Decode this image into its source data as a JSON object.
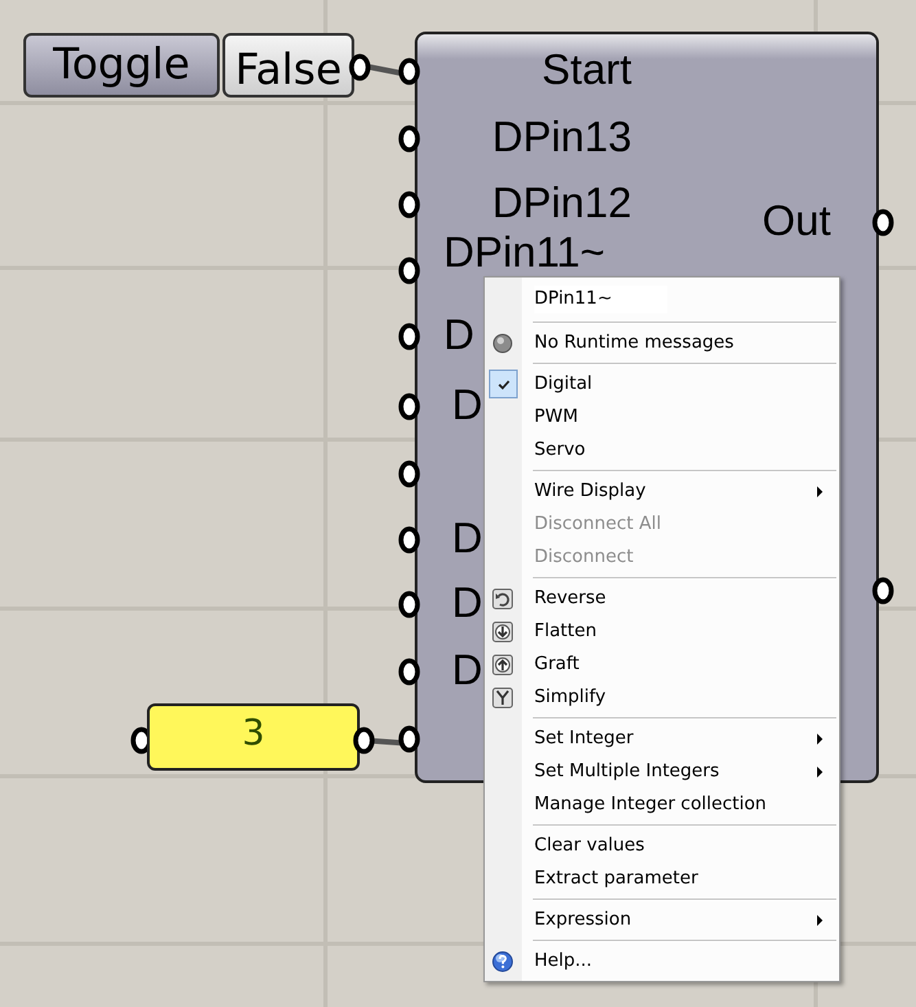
{
  "toggle": {
    "label": "Toggle",
    "value": "False"
  },
  "component": {
    "inputs": [
      {
        "kind": "labeled",
        "label": "Start"
      },
      {
        "kind": "labeled",
        "label": "DPin13"
      },
      {
        "kind": "labeled",
        "label": "DPin12"
      },
      {
        "kind": "labeled",
        "label": "DPin11~"
      },
      {
        "kind": "labeled",
        "label": "D"
      },
      {
        "kind": "labeled",
        "label": "D"
      },
      {
        "kind": "unlabeled"
      },
      {
        "kind": "labeled",
        "label": "D"
      },
      {
        "kind": "labeled",
        "label": "D"
      },
      {
        "kind": "labeled",
        "label": "D"
      },
      {
        "kind": "unlabeled"
      }
    ],
    "outputs": [
      {
        "kind": "labeled",
        "label": "Out"
      },
      {
        "kind": "unlabeled"
      }
    ]
  },
  "integer_panel": {
    "value": "3"
  },
  "context_menu": {
    "title": "DPin11~",
    "items": [
      {
        "kind": "separator"
      },
      {
        "kind": "item",
        "label": "No Runtime messages",
        "checked": false,
        "disabled": false,
        "submenu": false
      },
      {
        "kind": "separator"
      },
      {
        "kind": "item",
        "label": "Digital",
        "checked": true,
        "disabled": false,
        "submenu": false
      },
      {
        "kind": "item",
        "label": "PWM",
        "checked": false,
        "disabled": false,
        "submenu": false
      },
      {
        "kind": "item",
        "label": "Servo",
        "checked": false,
        "disabled": false,
        "submenu": false
      },
      {
        "kind": "separator"
      },
      {
        "kind": "item",
        "label": "Wire Display",
        "checked": false,
        "disabled": false,
        "submenu": true
      },
      {
        "kind": "item",
        "label": "Disconnect All",
        "checked": false,
        "disabled": true,
        "submenu": false
      },
      {
        "kind": "item",
        "label": "Disconnect",
        "checked": false,
        "disabled": true,
        "submenu": false
      },
      {
        "kind": "separator"
      },
      {
        "kind": "item",
        "label": "Reverse",
        "checked": false,
        "disabled": false,
        "submenu": false
      },
      {
        "kind": "item",
        "label": "Flatten",
        "checked": false,
        "disabled": false,
        "submenu": false
      },
      {
        "kind": "item",
        "label": "Graft",
        "checked": false,
        "disabled": false,
        "submenu": false
      },
      {
        "kind": "item",
        "label": "Simplify",
        "checked": false,
        "disabled": false,
        "submenu": false
      },
      {
        "kind": "separator"
      },
      {
        "kind": "item",
        "label": "Set Integer",
        "checked": false,
        "disabled": false,
        "submenu": true
      },
      {
        "kind": "item",
        "label": "Set Multiple Integers",
        "checked": false,
        "disabled": false,
        "submenu": true
      },
      {
        "kind": "item",
        "label": "Manage Integer collection",
        "checked": false,
        "disabled": false,
        "submenu": false
      },
      {
        "kind": "separator"
      },
      {
        "kind": "item",
        "label": "Clear values",
        "checked": false,
        "disabled": false,
        "submenu": false
      },
      {
        "kind": "item",
        "label": "Extract parameter",
        "checked": false,
        "disabled": false,
        "submenu": false
      },
      {
        "kind": "separator"
      },
      {
        "kind": "item",
        "label": "Expression",
        "checked": false,
        "disabled": false,
        "submenu": true
      },
      {
        "kind": "separator"
      },
      {
        "kind": "item",
        "label": "Help...",
        "checked": false,
        "disabled": false,
        "submenu": false
      }
    ]
  }
}
